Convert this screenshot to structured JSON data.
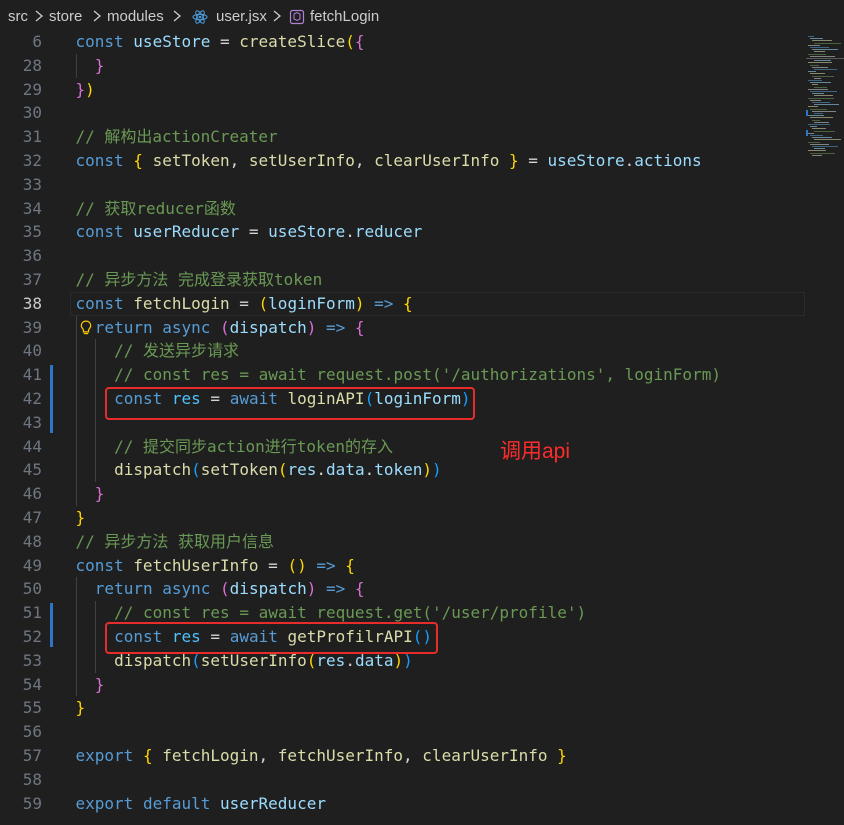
{
  "breadcrumb": {
    "items": [
      "src",
      "store",
      "modules",
      "user.jsx",
      "fetchLogin"
    ],
    "file_icon": "react-icon",
    "symbol_icon": "function-cube-icon"
  },
  "annotation": "调用api",
  "active_line": "38",
  "lines": [
    {
      "n": "6",
      "indent": 0,
      "tokens": [
        [
          "kw",
          "const "
        ],
        [
          "var",
          "useStore"
        ],
        [
          "txt",
          " = "
        ],
        [
          "fn",
          "createSlice"
        ],
        [
          "b1",
          "("
        ],
        [
          "b2",
          "{"
        ]
      ]
    },
    {
      "n": "28",
      "indent": 1,
      "tokens": [
        [
          "b2",
          "}"
        ]
      ]
    },
    {
      "n": "29",
      "indent": 0,
      "tokens": [
        [
          "b2",
          "}"
        ],
        [
          "b1",
          ")"
        ]
      ]
    },
    {
      "n": "30",
      "indent": 0,
      "tokens": []
    },
    {
      "n": "31",
      "indent": 0,
      "tokens": [
        [
          "cm",
          "// 解构出actionCreater"
        ]
      ]
    },
    {
      "n": "32",
      "indent": 0,
      "tokens": [
        [
          "kw",
          "const "
        ],
        [
          "b1",
          "{ "
        ],
        [
          "fn",
          "setToken"
        ],
        [
          "txt",
          ", "
        ],
        [
          "fn",
          "setUserInfo"
        ],
        [
          "txt",
          ", "
        ],
        [
          "fn",
          "clearUserInfo"
        ],
        [
          "b1",
          " }"
        ],
        [
          "txt",
          " = "
        ],
        [
          "var",
          "useStore"
        ],
        [
          "txt",
          "."
        ],
        [
          "var",
          "actions"
        ]
      ]
    },
    {
      "n": "33",
      "indent": 0,
      "tokens": []
    },
    {
      "n": "34",
      "indent": 0,
      "tokens": [
        [
          "cm",
          "// 获取reducer函数"
        ]
      ]
    },
    {
      "n": "35",
      "indent": 0,
      "tokens": [
        [
          "kw",
          "const "
        ],
        [
          "var",
          "userReducer"
        ],
        [
          "txt",
          " = "
        ],
        [
          "var",
          "useStore"
        ],
        [
          "txt",
          "."
        ],
        [
          "var",
          "reducer"
        ]
      ]
    },
    {
      "n": "36",
      "indent": 0,
      "tokens": []
    },
    {
      "n": "37",
      "indent": 0,
      "tokens": [
        [
          "cm",
          "// 异步方法 完成登录获取token"
        ]
      ]
    },
    {
      "n": "38",
      "indent": 0,
      "tokens": [
        [
          "kw",
          "const "
        ],
        [
          "fn",
          "fetchLogin"
        ],
        [
          "txt",
          " = "
        ],
        [
          "b1",
          "("
        ],
        [
          "var",
          "loginForm"
        ],
        [
          "b1",
          ")"
        ],
        [
          "kw",
          " => "
        ],
        [
          "b1",
          "{"
        ]
      ]
    },
    {
      "n": "39",
      "indent": 1,
      "tokens": [
        [
          "kw",
          "return "
        ],
        [
          "kw",
          "async "
        ],
        [
          "b2",
          "("
        ],
        [
          "var",
          "dispatch"
        ],
        [
          "b2",
          ")"
        ],
        [
          "kw",
          " => "
        ],
        [
          "b2",
          "{"
        ]
      ]
    },
    {
      "n": "40",
      "indent": 2,
      "tokens": [
        [
          "cm",
          "// 发送异步请求"
        ]
      ]
    },
    {
      "n": "41",
      "indent": 2,
      "tokens": [
        [
          "cm",
          "// const res = await request.post('/authorizations', loginForm)"
        ]
      ]
    },
    {
      "n": "42",
      "indent": 2,
      "tokens": [
        [
          "kw",
          "const "
        ],
        [
          "cst",
          "res"
        ],
        [
          "txt",
          " = "
        ],
        [
          "kw",
          "await "
        ],
        [
          "fn",
          "loginAPI"
        ],
        [
          "b3",
          "("
        ],
        [
          "var",
          "loginForm"
        ],
        [
          "b3",
          ")"
        ]
      ]
    },
    {
      "n": "43",
      "indent": 2,
      "tokens": []
    },
    {
      "n": "44",
      "indent": 2,
      "tokens": [
        [
          "cm",
          "// 提交同步action进行token的存入"
        ]
      ]
    },
    {
      "n": "45",
      "indent": 2,
      "tokens": [
        [
          "fn",
          "dispatch"
        ],
        [
          "b3",
          "("
        ],
        [
          "fn",
          "setToken"
        ],
        [
          "b1",
          "("
        ],
        [
          "var",
          "res"
        ],
        [
          "txt",
          "."
        ],
        [
          "var",
          "data"
        ],
        [
          "txt",
          "."
        ],
        [
          "var",
          "token"
        ],
        [
          "b1",
          ")"
        ],
        [
          "b3",
          ")"
        ]
      ]
    },
    {
      "n": "46",
      "indent": 1,
      "tokens": [
        [
          "b2",
          "}"
        ]
      ]
    },
    {
      "n": "47",
      "indent": 0,
      "tokens": [
        [
          "b1",
          "}"
        ]
      ]
    },
    {
      "n": "48",
      "indent": 0,
      "tokens": [
        [
          "cm",
          "// 异步方法 获取用户信息"
        ]
      ]
    },
    {
      "n": "49",
      "indent": 0,
      "tokens": [
        [
          "kw",
          "const "
        ],
        [
          "fn",
          "fetchUserInfo"
        ],
        [
          "txt",
          " = "
        ],
        [
          "b1",
          "()"
        ],
        [
          "kw",
          " => "
        ],
        [
          "b1",
          "{"
        ]
      ]
    },
    {
      "n": "50",
      "indent": 1,
      "tokens": [
        [
          "kw",
          "return "
        ],
        [
          "kw",
          "async "
        ],
        [
          "b2",
          "("
        ],
        [
          "var",
          "dispatch"
        ],
        [
          "b2",
          ")"
        ],
        [
          "kw",
          " => "
        ],
        [
          "b2",
          "{"
        ]
      ]
    },
    {
      "n": "51",
      "indent": 2,
      "tokens": [
        [
          "cm",
          "// const res = await request.get('/user/profile')"
        ]
      ]
    },
    {
      "n": "52",
      "indent": 2,
      "tokens": [
        [
          "kw",
          "const "
        ],
        [
          "cst",
          "res"
        ],
        [
          "txt",
          " = "
        ],
        [
          "kw",
          "await "
        ],
        [
          "fn",
          "getProfilrAPI"
        ],
        [
          "b3",
          "()"
        ]
      ]
    },
    {
      "n": "53",
      "indent": 2,
      "tokens": [
        [
          "fn",
          "dispatch"
        ],
        [
          "b3",
          "("
        ],
        [
          "fn",
          "setUserInfo"
        ],
        [
          "b1",
          "("
        ],
        [
          "var",
          "res"
        ],
        [
          "txt",
          "."
        ],
        [
          "var",
          "data"
        ],
        [
          "b1",
          ")"
        ],
        [
          "b3",
          ")"
        ]
      ]
    },
    {
      "n": "54",
      "indent": 1,
      "tokens": [
        [
          "b2",
          "}"
        ]
      ]
    },
    {
      "n": "55",
      "indent": 0,
      "tokens": [
        [
          "b1",
          "}"
        ]
      ]
    },
    {
      "n": "56",
      "indent": 0,
      "tokens": []
    },
    {
      "n": "57",
      "indent": 0,
      "tokens": [
        [
          "kw",
          "export "
        ],
        [
          "b1",
          "{ "
        ],
        [
          "fn",
          "fetchLogin"
        ],
        [
          "txt",
          ", "
        ],
        [
          "fn",
          "fetchUserInfo"
        ],
        [
          "txt",
          ", "
        ],
        [
          "fn",
          "clearUserInfo"
        ],
        [
          "b1",
          " }"
        ]
      ]
    },
    {
      "n": "58",
      "indent": 0,
      "tokens": []
    },
    {
      "n": "59",
      "indent": 0,
      "tokens": [
        [
          "kw",
          "export "
        ],
        [
          "kw",
          "default "
        ],
        [
          "var",
          "userReducer"
        ]
      ]
    }
  ]
}
